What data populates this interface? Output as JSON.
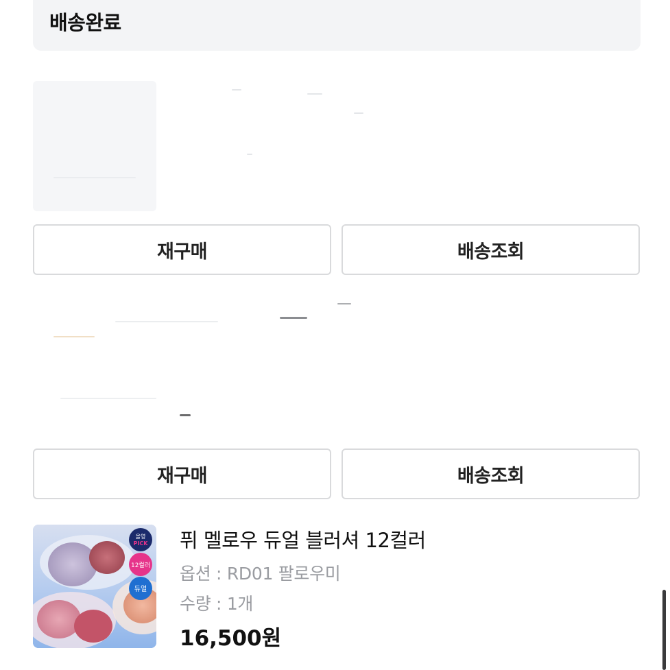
{
  "status": {
    "title": "배송완료"
  },
  "orders": [
    {
      "repurchase_label": "재구매",
      "tracking_label": "배송조회"
    },
    {
      "repurchase_label": "재구매",
      "tracking_label": "배송조회"
    }
  ],
  "product": {
    "name": "퓌 멜로우 듀얼 블러셔 12컬러",
    "option": "옵션 : RD01 팔로우미",
    "quantity": "수량 : 1개",
    "price": "16,500",
    "price_unit": "원",
    "badges": [
      "올영 PICK",
      "12컬러",
      "듀얼"
    ]
  },
  "colors": {
    "banner_bg": "#f3f4f6",
    "button_border": "#d9dadc",
    "muted_text": "#9a9ca1",
    "badge_navy": "#1b2a6b",
    "badge_pink": "#e6348a",
    "badge_blue": "#1f6fd1"
  }
}
